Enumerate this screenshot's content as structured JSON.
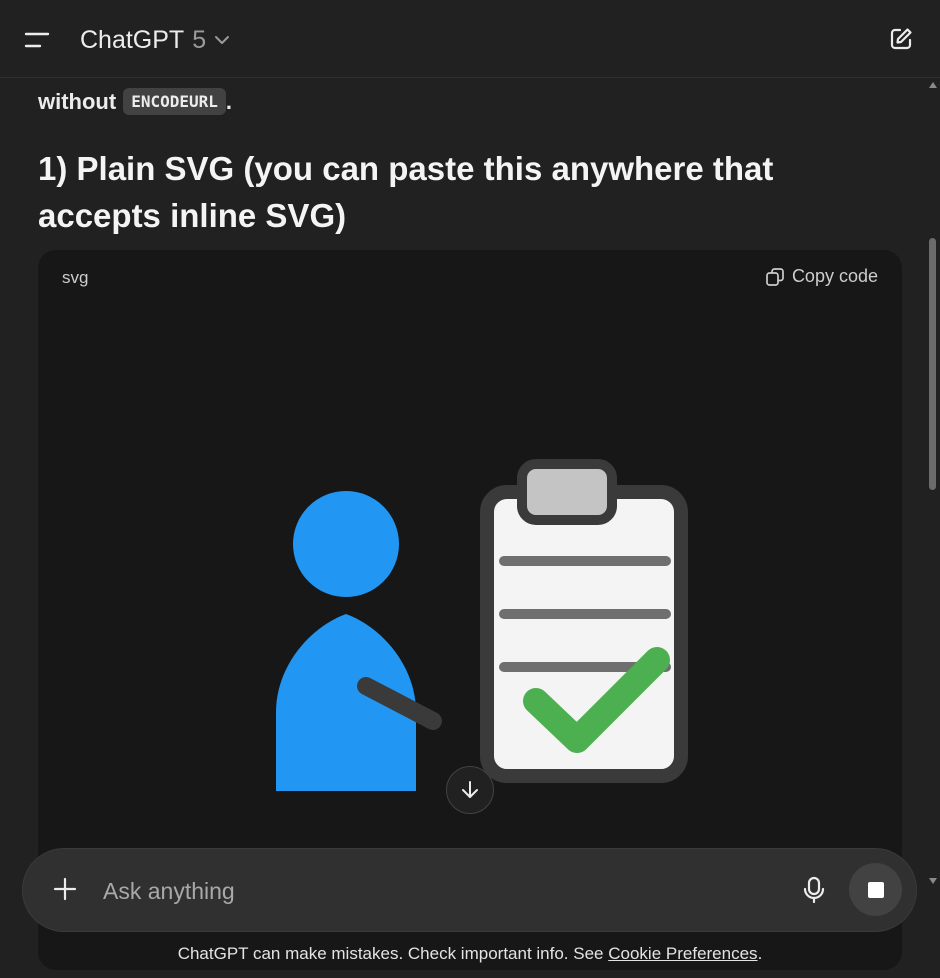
{
  "header": {
    "model_name": "ChatGPT",
    "model_version": "5"
  },
  "message": {
    "intro_text": "without",
    "inline_code": "ENCODEURL",
    "intro_end": ".",
    "heading": "1) Plain SVG (you can paste this anywhere that accepts inline SVG)"
  },
  "code_block": {
    "language": "svg",
    "copy_label": "Copy code"
  },
  "illustration": {
    "person_color": "#2196F3",
    "checkmark_color": "#4CAF50",
    "clipboard_bg": "#f4f4f4",
    "clipboard_border": "#3a3a3a",
    "clip_color": "#c4c4c4",
    "line_color": "#6f6f6f"
  },
  "composer": {
    "placeholder": "Ask anything"
  },
  "footer": {
    "disclaimer": "ChatGPT can make mistakes. Check important info. See",
    "link": "Cookie Preferences",
    "end": "."
  },
  "colors": {
    "background": "#212121",
    "code_bg": "#171717",
    "composer_bg": "#303030"
  }
}
